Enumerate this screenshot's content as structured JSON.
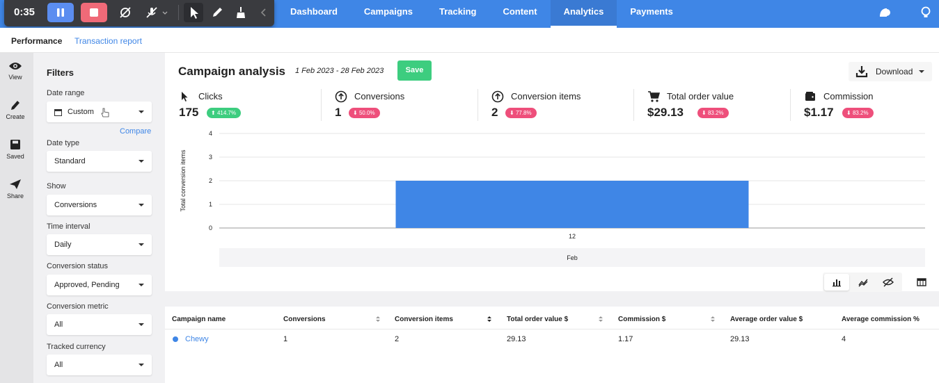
{
  "recorder": {
    "time": "0:35"
  },
  "nav": {
    "tabs": [
      "Dashboard",
      "Campaigns",
      "Tracking",
      "Content",
      "Analytics",
      "Payments"
    ],
    "active": "Analytics"
  },
  "subnav": {
    "performance": "Performance",
    "transaction_report": "Transaction report"
  },
  "rail": {
    "view": "View",
    "create": "Create",
    "saved": "Saved",
    "share": "Share"
  },
  "filters": {
    "title": "Filters",
    "compare": "Compare",
    "fields": [
      {
        "label": "Date range",
        "value": "Custom"
      },
      {
        "label": "Date type",
        "value": "Standard"
      },
      {
        "label": "Show",
        "value": "Conversions"
      },
      {
        "label": "Time interval",
        "value": "Daily"
      },
      {
        "label": "Conversion status",
        "value": "Approved, Pending"
      },
      {
        "label": "Conversion metric",
        "value": "All"
      },
      {
        "label": "Tracked currency",
        "value": "All"
      }
    ]
  },
  "analysis": {
    "title": "Campaign analysis",
    "daterange": "1 Feb 2023 - 28 Feb 2023",
    "save_label": "Save",
    "download_label": "Download"
  },
  "metrics": [
    {
      "label": "Clicks",
      "value": "175",
      "change": "414.7%",
      "direction": "up",
      "icon": "cursor-icon"
    },
    {
      "label": "Conversions",
      "value": "1",
      "change": "50.0%",
      "direction": "down",
      "icon": "arrow-up-circle-icon"
    },
    {
      "label": "Conversion items",
      "value": "2",
      "change": "77.8%",
      "direction": "down",
      "icon": "arrow-up-circle-icon"
    },
    {
      "label": "Total order value",
      "value": "$29.13",
      "change": "83.2%",
      "direction": "down",
      "icon": "cart-icon"
    },
    {
      "label": "Commission",
      "value": "$1.17",
      "change": "83.2%",
      "direction": "down",
      "icon": "wallet-icon"
    }
  ],
  "chart_data": {
    "type": "bar",
    "categories": [
      "12"
    ],
    "values": [
      2
    ],
    "ylabel": "Total conversion items",
    "xlabel": "Feb",
    "ylim": [
      0,
      4
    ],
    "yticks": [
      "0",
      "1",
      "2",
      "3",
      "4"
    ],
    "grid": true,
    "colors": {
      "bar": "#3f86e6"
    }
  },
  "table": {
    "headers": [
      "Campaign name",
      "Conversions",
      "Conversion items",
      "Total order value $",
      "Commission $",
      "Average order value $",
      "Average commission %"
    ],
    "rows": [
      [
        "Chewy",
        "1",
        "2",
        "29.13",
        "1.17",
        "29.13",
        "4"
      ]
    ]
  },
  "colors": {
    "nav": "#3f86e6",
    "accent": "#3f86e6",
    "save": "#3dcd7f",
    "badge_up": "#3dcd7f",
    "badge_down": "#ee4f7b"
  }
}
